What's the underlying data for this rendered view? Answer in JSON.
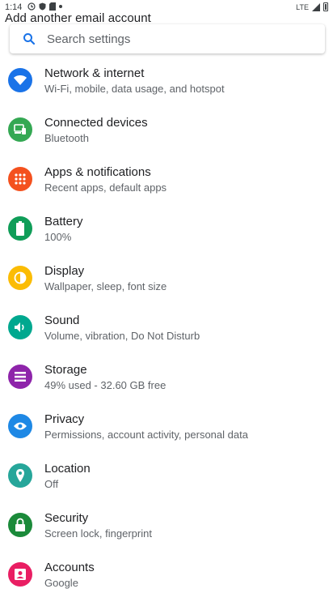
{
  "status_bar": {
    "time": "1:14",
    "network": "LTE"
  },
  "overlay_text": "Add another email account",
  "search": {
    "placeholder": "Search settings"
  },
  "settings": [
    {
      "title": "Network & internet",
      "subtitle": "Wi-Fi, mobile, data usage, and hotspot",
      "color": "#1a73e8",
      "icon": "wifi-icon"
    },
    {
      "title": "Connected devices",
      "subtitle": "Bluetooth",
      "color": "#34a853",
      "icon": "devices-icon"
    },
    {
      "title": "Apps & notifications",
      "subtitle": "Recent apps, default apps",
      "color": "#f4511e",
      "icon": "apps-icon"
    },
    {
      "title": "Battery",
      "subtitle": "100%",
      "color": "#0f9d58",
      "icon": "battery-icon"
    },
    {
      "title": "Display",
      "subtitle": "Wallpaper, sleep, font size",
      "color": "#fbbc04",
      "icon": "brightness-icon"
    },
    {
      "title": "Sound",
      "subtitle": "Volume, vibration, Do Not Disturb",
      "color": "#00a88f",
      "icon": "volume-icon"
    },
    {
      "title": "Storage",
      "subtitle": "49% used - 32.60 GB free",
      "color": "#8e24aa",
      "icon": "storage-icon"
    },
    {
      "title": "Privacy",
      "subtitle": "Permissions, account activity, personal data",
      "color": "#1e88e5",
      "icon": "privacy-icon"
    },
    {
      "title": "Location",
      "subtitle": "Off",
      "color": "#26a69a",
      "icon": "location-icon"
    },
    {
      "title": "Security",
      "subtitle": "Screen lock, fingerprint",
      "color": "#1b8a3a",
      "icon": "lock-icon"
    },
    {
      "title": "Accounts",
      "subtitle": "Google",
      "color": "#e91e63",
      "icon": "account-icon"
    }
  ]
}
